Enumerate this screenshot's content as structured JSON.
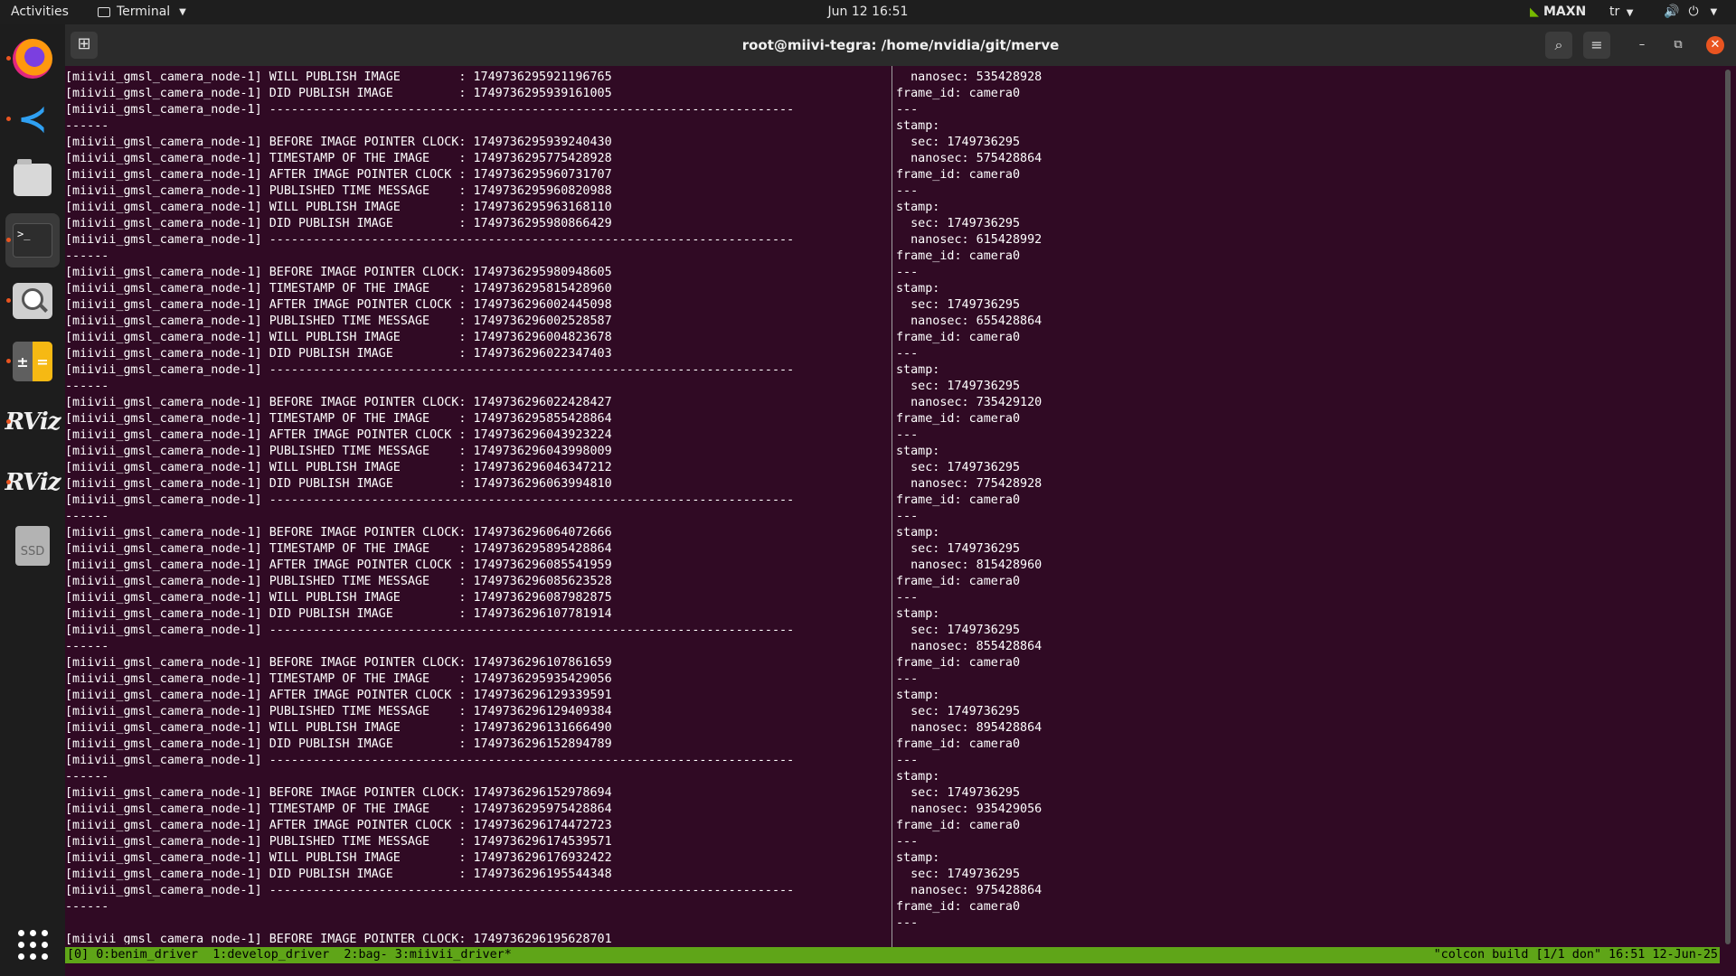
{
  "topbar": {
    "activities": "Activities",
    "app_menu": "Terminal",
    "clock": "Jun 12  16:51",
    "power_mode": "MAXN",
    "language": "tr"
  },
  "dock": {
    "items": [
      "firefox-icon",
      "vscode-icon",
      "files-icon",
      "terminal-icon",
      "image-viewer-icon",
      "calculator-icon",
      "rviz-icon",
      "rviz-icon",
      "ssd-drive-icon",
      "app-grid-icon"
    ],
    "rviz_label": "RViz",
    "ssd_label": "SSD"
  },
  "window": {
    "title": "root@miivi-tegra: /home/nvidia/git/merve"
  },
  "terminal": {
    "left_pane_lines": [
      "[miivii_gmsl_camera_node-1] WILL PUBLISH IMAGE        : 1749736295921196765",
      "[miivii_gmsl_camera_node-1] DID PUBLISH IMAGE         : 1749736295939161005",
      "[miivii_gmsl_camera_node-1] ------------------------------------------------------------------------",
      "------",
      "[miivii_gmsl_camera_node-1] BEFORE IMAGE POINTER CLOCK: 1749736295939240430",
      "[miivii_gmsl_camera_node-1] TIMESTAMP OF THE IMAGE    : 1749736295775428928",
      "[miivii_gmsl_camera_node-1] AFTER IMAGE POINTER CLOCK : 1749736295960731707",
      "[miivii_gmsl_camera_node-1] PUBLISHED TIME MESSAGE    : 1749736295960820988",
      "[miivii_gmsl_camera_node-1] WILL PUBLISH IMAGE        : 1749736295963168110",
      "[miivii_gmsl_camera_node-1] DID PUBLISH IMAGE         : 1749736295980866429",
      "[miivii_gmsl_camera_node-1] ------------------------------------------------------------------------",
      "------",
      "[miivii_gmsl_camera_node-1] BEFORE IMAGE POINTER CLOCK: 1749736295980948605",
      "[miivii_gmsl_camera_node-1] TIMESTAMP OF THE IMAGE    : 1749736295815428960",
      "[miivii_gmsl_camera_node-1] AFTER IMAGE POINTER CLOCK : 1749736296002445098",
      "[miivii_gmsl_camera_node-1] PUBLISHED TIME MESSAGE    : 1749736296002528587",
      "[miivii_gmsl_camera_node-1] WILL PUBLISH IMAGE        : 1749736296004823678",
      "[miivii_gmsl_camera_node-1] DID PUBLISH IMAGE         : 1749736296022347403",
      "[miivii_gmsl_camera_node-1] ------------------------------------------------------------------------",
      "------",
      "[miivii_gmsl_camera_node-1] BEFORE IMAGE POINTER CLOCK: 1749736296022428427",
      "[miivii_gmsl_camera_node-1] TIMESTAMP OF THE IMAGE    : 1749736295855428864",
      "[miivii_gmsl_camera_node-1] AFTER IMAGE POINTER CLOCK : 1749736296043923224",
      "[miivii_gmsl_camera_node-1] PUBLISHED TIME MESSAGE    : 1749736296043998009",
      "[miivii_gmsl_camera_node-1] WILL PUBLISH IMAGE        : 1749736296046347212",
      "[miivii_gmsl_camera_node-1] DID PUBLISH IMAGE         : 1749736296063994810",
      "[miivii_gmsl_camera_node-1] ------------------------------------------------------------------------",
      "------",
      "[miivii_gmsl_camera_node-1] BEFORE IMAGE POINTER CLOCK: 1749736296064072666",
      "[miivii_gmsl_camera_node-1] TIMESTAMP OF THE IMAGE    : 1749736295895428864",
      "[miivii_gmsl_camera_node-1] AFTER IMAGE POINTER CLOCK : 1749736296085541959",
      "[miivii_gmsl_camera_node-1] PUBLISHED TIME MESSAGE    : 1749736296085623528",
      "[miivii_gmsl_camera_node-1] WILL PUBLISH IMAGE        : 1749736296087982875",
      "[miivii_gmsl_camera_node-1] DID PUBLISH IMAGE         : 1749736296107781914",
      "[miivii_gmsl_camera_node-1] ------------------------------------------------------------------------",
      "------",
      "[miivii_gmsl_camera_node-1] BEFORE IMAGE POINTER CLOCK: 1749736296107861659",
      "[miivii_gmsl_camera_node-1] TIMESTAMP OF THE IMAGE    : 1749736295935429056",
      "[miivii_gmsl_camera_node-1] AFTER IMAGE POINTER CLOCK : 1749736296129339591",
      "[miivii_gmsl_camera_node-1] PUBLISHED TIME MESSAGE    : 1749736296129409384",
      "[miivii_gmsl_camera_node-1] WILL PUBLISH IMAGE        : 1749736296131666490",
      "[miivii_gmsl_camera_node-1] DID PUBLISH IMAGE         : 1749736296152894789",
      "[miivii_gmsl_camera_node-1] ------------------------------------------------------------------------",
      "------",
      "[miivii_gmsl_camera_node-1] BEFORE IMAGE POINTER CLOCK: 1749736296152978694",
      "[miivii_gmsl_camera_node-1] TIMESTAMP OF THE IMAGE    : 1749736295975428864",
      "[miivii_gmsl_camera_node-1] AFTER IMAGE POINTER CLOCK : 1749736296174472723",
      "[miivii_gmsl_camera_node-1] PUBLISHED TIME MESSAGE    : 1749736296174539571",
      "[miivii_gmsl_camera_node-1] WILL PUBLISH IMAGE        : 1749736296176932422",
      "[miivii_gmsl_camera_node-1] DID PUBLISH IMAGE         : 1749736296195544348",
      "[miivii_gmsl_camera_node-1] ------------------------------------------------------------------------",
      "------",
      "",
      "[miivii_gmsl_camera_node-1] BEFORE IMAGE POINTER CLOCK: 1749736296195628701"
    ],
    "right_pane_lines": [
      "  nanosec: 535428928",
      "frame_id: camera0",
      "---",
      "stamp:",
      "  sec: 1749736295",
      "  nanosec: 575428864",
      "frame_id: camera0",
      "---",
      "stamp:",
      "  sec: 1749736295",
      "  nanosec: 615428992",
      "frame_id: camera0",
      "---",
      "stamp:",
      "  sec: 1749736295",
      "  nanosec: 655428864",
      "frame_id: camera0",
      "---",
      "stamp:",
      "  sec: 1749736295",
      "  nanosec: 735429120",
      "frame_id: camera0",
      "---",
      "stamp:",
      "  sec: 1749736295",
      "  nanosec: 775428928",
      "frame_id: camera0",
      "---",
      "stamp:",
      "  sec: 1749736295",
      "  nanosec: 815428960",
      "frame_id: camera0",
      "---",
      "stamp:",
      "  sec: 1749736295",
      "  nanosec: 855428864",
      "frame_id: camera0",
      "---",
      "stamp:",
      "  sec: 1749736295",
      "  nanosec: 895428864",
      "frame_id: camera0",
      "---",
      "stamp:",
      "  sec: 1749736295",
      "  nanosec: 935429056",
      "frame_id: camera0",
      "---",
      "stamp:",
      "  sec: 1749736295",
      "  nanosec: 975428864",
      "frame_id: camera0",
      "---"
    ],
    "left_pane_text": "",
    "right_pane_text": ""
  },
  "tmux": {
    "windows": "[0] 0:benim_driver  1:develop_driver  2:bag- 3:miivii_driver*",
    "status_right": "\"colcon build [1/1 don\" 16:51 12-Jun-25"
  },
  "colors": {
    "terminal_bg": "#300a24",
    "tmux_status_bg": "#5fa518",
    "close_button": "#e95420",
    "nvidia_green": "#76b900"
  }
}
